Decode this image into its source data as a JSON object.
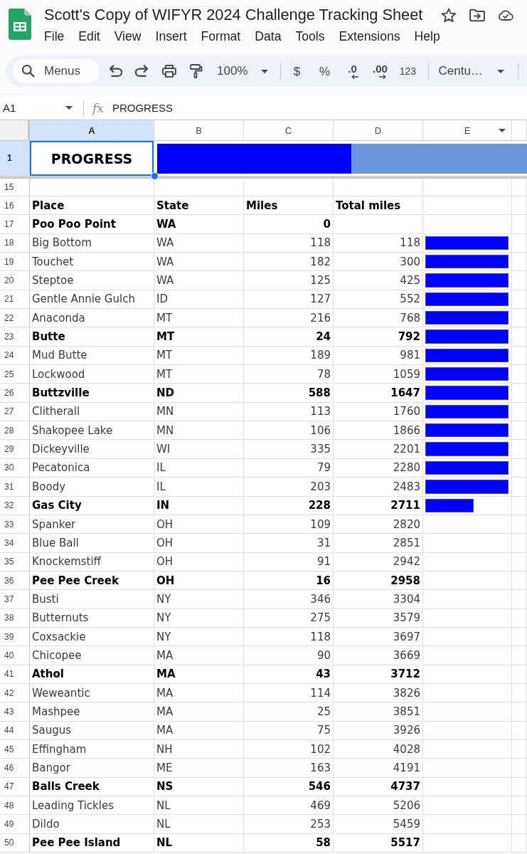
{
  "app": {
    "title": "Scott's Copy of WIFYR 2024 Challenge Tracking Sheet",
    "menu": [
      "File",
      "Edit",
      "View",
      "Insert",
      "Format",
      "Data",
      "Tools",
      "Extensions",
      "Help"
    ]
  },
  "toolbar": {
    "search": {
      "placeholder": "Menus"
    },
    "zoom": "100%",
    "format_buttons": [
      {
        "kind": "currency",
        "label": "$"
      },
      {
        "kind": "percent",
        "label": "%"
      },
      {
        "kind": "decrease-decimals",
        "label": ".0"
      },
      {
        "kind": "increase-decimals",
        "label": ".00"
      },
      {
        "kind": "number",
        "label": "123"
      }
    ],
    "font": "Centu…"
  },
  "formula_bar": {
    "cell_ref": "A1",
    "function_label": "fx",
    "formula": "PROGRESS"
  },
  "sheet": {
    "columns": [
      {
        "label": "A",
        "selected": true,
        "hovered": false
      },
      {
        "label": "B",
        "selected": false,
        "hovered": false
      },
      {
        "label": "C",
        "selected": false,
        "hovered": false
      },
      {
        "label": "D",
        "selected": false,
        "hovered": false
      },
      {
        "label": "E",
        "selected": false,
        "hovered": true
      }
    ],
    "frozen_row": {
      "number": "1",
      "selected": true,
      "title": {
        "text": "PROGRESS",
        "active": true
      },
      "level": 0.525
    },
    "rows": [
      {
        "number": "15",
        "selected": false,
        "kind": "blank"
      },
      {
        "number": "16",
        "selected": false,
        "kind": "header",
        "bold": true,
        "place": "Place",
        "state": "State",
        "miles": "Miles",
        "total": "Total miles"
      },
      {
        "number": "17",
        "selected": false,
        "kind": "stop",
        "bold": true,
        "place": "Poo Poo Point",
        "state": "WA",
        "miles": "0"
      },
      {
        "number": "18",
        "selected": false,
        "kind": "stop",
        "bold": false,
        "place": "Big Bottom",
        "state": "WA",
        "miles": "118",
        "total": "118",
        "level": 1
      },
      {
        "number": "19",
        "selected": false,
        "kind": "stop",
        "bold": false,
        "place": "Touchet",
        "state": "WA",
        "miles": "182",
        "total": "300",
        "level": 1
      },
      {
        "number": "20",
        "selected": false,
        "kind": "stop",
        "bold": false,
        "place": "Steptoe",
        "state": "WA",
        "miles": "125",
        "total": "425",
        "level": 1
      },
      {
        "number": "21",
        "selected": false,
        "kind": "stop",
        "bold": false,
        "place": "Gentle Annie Gulch",
        "state": "ID",
        "miles": "127",
        "total": "552",
        "level": 1
      },
      {
        "number": "22",
        "selected": false,
        "kind": "stop",
        "bold": false,
        "place": "Anaconda",
        "state": "MT",
        "miles": "216",
        "total": "768",
        "level": 1
      },
      {
        "number": "23",
        "selected": false,
        "kind": "stop",
        "bold": true,
        "place": "Butte",
        "state": "MT",
        "miles": "24",
        "total": "792",
        "level": 1
      },
      {
        "number": "24",
        "selected": false,
        "kind": "stop",
        "bold": false,
        "place": "Mud Butte",
        "state": "MT",
        "miles": "189",
        "total": "981",
        "level": 1
      },
      {
        "number": "25",
        "selected": false,
        "kind": "stop",
        "bold": false,
        "place": "Lockwood",
        "state": "MT",
        "miles": "78",
        "total": "1059",
        "level": 1
      },
      {
        "number": "26",
        "selected": false,
        "kind": "stop",
        "bold": true,
        "place": "Buttzville",
        "state": "ND",
        "miles": "588",
        "total": "1647",
        "level": 1
      },
      {
        "number": "27",
        "selected": false,
        "kind": "stop",
        "bold": false,
        "place": "Clitherall",
        "state": "MN",
        "miles": "113",
        "total": "1760",
        "level": 1
      },
      {
        "number": "28",
        "selected": false,
        "kind": "stop",
        "bold": false,
        "place": "Shakopee Lake",
        "state": "MN",
        "miles": "106",
        "total": "1866",
        "level": 1
      },
      {
        "number": "29",
        "selected": false,
        "kind": "stop",
        "bold": false,
        "place": "Dickeyville",
        "state": "WI",
        "miles": "335",
        "total": "2201",
        "level": 1
      },
      {
        "number": "30",
        "selected": false,
        "kind": "stop",
        "bold": false,
        "place": "Pecatonica",
        "state": "IL",
        "miles": "79",
        "total": "2280",
        "level": 1
      },
      {
        "number": "31",
        "selected": false,
        "kind": "stop",
        "bold": false,
        "place": "Boody",
        "state": "IL",
        "miles": "203",
        "total": "2483",
        "level": 1
      },
      {
        "number": "32",
        "selected": false,
        "kind": "stop",
        "bold": true,
        "place": "Gas City",
        "state": "IN",
        "miles": "228",
        "total": "2711",
        "level": 0.58
      },
      {
        "number": "33",
        "selected": false,
        "kind": "stop",
        "bold": false,
        "place": "Spanker",
        "state": "OH",
        "miles": "109",
        "total": "2820"
      },
      {
        "number": "34",
        "selected": false,
        "kind": "stop",
        "bold": false,
        "place": "Blue Ball",
        "state": "OH",
        "miles": "31",
        "total": "2851"
      },
      {
        "number": "35",
        "selected": false,
        "kind": "stop",
        "bold": false,
        "place": "Knockemstiff",
        "state": "OH",
        "miles": "91",
        "total": "2942"
      },
      {
        "number": "36",
        "selected": false,
        "kind": "stop",
        "bold": true,
        "place": "Pee Pee Creek",
        "state": "OH",
        "miles": "16",
        "total": "2958"
      },
      {
        "number": "37",
        "selected": false,
        "kind": "stop",
        "bold": false,
        "place": "Busti",
        "state": "NY",
        "miles": "346",
        "total": "3304"
      },
      {
        "number": "38",
        "selected": false,
        "kind": "stop",
        "bold": false,
        "place": "Butternuts",
        "state": "NY",
        "miles": "275",
        "total": "3579"
      },
      {
        "number": "39",
        "selected": false,
        "kind": "stop",
        "bold": false,
        "place": "Coxsackie",
        "state": "NY",
        "miles": "118",
        "total": "3697"
      },
      {
        "number": "40",
        "selected": false,
        "kind": "stop",
        "bold": false,
        "place": "Chicopee",
        "state": "MA",
        "miles": "90",
        "total": "3669"
      },
      {
        "number": "41",
        "selected": false,
        "kind": "stop",
        "bold": true,
        "place": "Athol",
        "state": "MA",
        "miles": "43",
        "total": "3712"
      },
      {
        "number": "42",
        "selected": false,
        "kind": "stop",
        "bold": false,
        "place": "Weweantic",
        "state": "MA",
        "miles": "114",
        "total": "3826"
      },
      {
        "number": "43",
        "selected": false,
        "kind": "stop",
        "bold": false,
        "place": "Mashpee",
        "state": "MA",
        "miles": "25",
        "total": "3851"
      },
      {
        "number": "44",
        "selected": false,
        "kind": "stop",
        "bold": false,
        "place": "Saugus",
        "state": "MA",
        "miles": "75",
        "total": "3926"
      },
      {
        "number": "45",
        "selected": false,
        "kind": "stop",
        "bold": false,
        "place": "Effingham",
        "state": "NH",
        "miles": "102",
        "total": "4028"
      },
      {
        "number": "46",
        "selected": false,
        "kind": "stop",
        "bold": false,
        "place": "Bangor",
        "state": "ME",
        "miles": "163",
        "total": "4191"
      },
      {
        "number": "47",
        "selected": false,
        "kind": "stop",
        "bold": true,
        "place": "Balls Creek",
        "state": "NS",
        "miles": "546",
        "total": "4737"
      },
      {
        "number": "48",
        "selected": false,
        "kind": "stop",
        "bold": false,
        "place": "Leading Tickles",
        "state": "NL",
        "miles": "469",
        "total": "5206"
      },
      {
        "number": "49",
        "selected": false,
        "kind": "stop",
        "bold": false,
        "place": "Dildo",
        "state": "NL",
        "miles": "253",
        "total": "5459"
      },
      {
        "number": "50",
        "selected": false,
        "kind": "stop",
        "bold": true,
        "place": "Pee Pee Island",
        "state": "NL",
        "miles": "58",
        "total": "5517"
      }
    ]
  }
}
